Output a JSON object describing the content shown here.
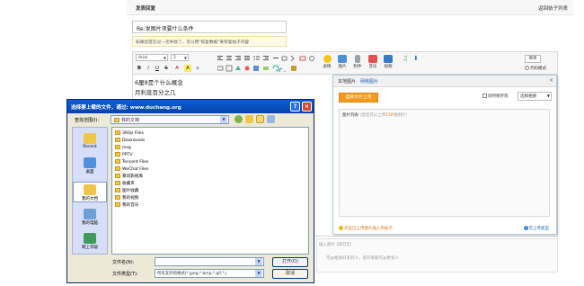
{
  "header": {
    "active_tab": "发表回复",
    "right_link": "返回帖子列表"
  },
  "post": {
    "title_value": "Re:发图片须要什么条件",
    "restore_tip": "如果您提交过一次失败了，可以用\"恢复数据\"来恢复帖子内容"
  },
  "toolbar": {
    "font": "Arial",
    "size": "2",
    "format_buttons": [
      "B",
      "I",
      "U",
      "S",
      "A",
      "A",
      "⌀"
    ],
    "big_buttons": [
      {
        "label": "表情",
        "icon": "smiley-icon",
        "color": "#f5c518"
      },
      {
        "label": "图片",
        "icon": "image-icon",
        "color": "#4a8fd8"
      },
      {
        "label": "附件",
        "icon": "attachment-icon",
        "color": "#7a7a7a"
      },
      {
        "label": "音乐",
        "icon": "music-icon",
        "color": "#e05050"
      },
      {
        "label": "视频",
        "icon": "video-icon",
        "color": "#3a78c8"
      }
    ],
    "simple_label": "简单",
    "code_mode_label": "代码模式"
  },
  "editor": {
    "lines": [
      "6厘8是个什么概念",
      "月利息百分之几"
    ]
  },
  "image_panel": {
    "tabs": [
      "本地图片",
      "网络图片"
    ],
    "upload_button": "选择文件上传",
    "sync_label": "同时保存到",
    "album_select": "选择相册",
    "list_header": "图片列表",
    "list_hint_prefix": "(您还可以上传",
    "list_hint_num": "150",
    "list_hint_suffix": "张图片)",
    "foot_left": "点击已上传图片插入到帖子",
    "foot_right": "可上传类型"
  },
  "sub_area": {
    "line1": "插入图片 (限可见)",
    "line2": "可@相关好友的人，提升等级可@更多人"
  },
  "dialog": {
    "title": "选择要上载的文件，通过: www.duchang.org",
    "help_label": "?",
    "close_label": "×",
    "lookin_label": "查找范围(I):",
    "lookin_value": "我的文档",
    "places": [
      "Recent",
      "桌面",
      "我的文档",
      "我的电脑",
      "网上邻居"
    ],
    "files": [
      "360js Files",
      "Downloads",
      "msg",
      "PPTV",
      "Tencent Files",
      "WeChat Files",
      "暴风影视库",
      "收藏夹",
      "图片收藏",
      "我的视频",
      "我的音乐"
    ],
    "filename_label": "文件名(N):",
    "filename_value": "",
    "filetype_label": "文件类型(T):",
    "filetype_value": "所有支持的格式(*.jpeg,*.bmp,*.gif,*.j",
    "open_label": "打开(O)",
    "cancel_label": "取消"
  }
}
